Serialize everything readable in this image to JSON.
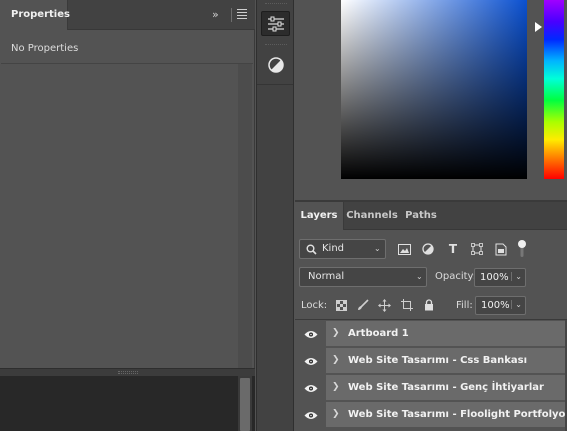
{
  "properties": {
    "tab_label": "Properties",
    "empty_message": "No Properties"
  },
  "icon_strip": {
    "buttons": [
      {
        "icon": "adjustments-sliders-icon",
        "active": true
      },
      {
        "icon": "color-adjustment-circle-icon",
        "active": false
      }
    ]
  },
  "layers": {
    "tabs": [
      {
        "label": "Layers",
        "active": true
      },
      {
        "label": "Channels",
        "active": false
      },
      {
        "label": "Paths",
        "active": false
      }
    ],
    "filter": {
      "kind_label": "Kind",
      "icons": [
        "image-filter-icon",
        "adjustment-filter-icon",
        "type-filter-icon",
        "shape-filter-icon",
        "smart-object-filter-icon"
      ]
    },
    "blend_mode": "Normal",
    "opacity_label": "Opacity:",
    "opacity_value": "100%",
    "lock_label": "Lock:",
    "lock_icons": [
      "lock-transparency-icon",
      "lock-image-icon",
      "lock-position-icon",
      "lock-artboard-icon",
      "lock-all-icon"
    ],
    "fill_label": "Fill:",
    "fill_value": "100%",
    "rows": [
      {
        "name": "Artboard 1"
      },
      {
        "name": "Web Site Tasarımı - Css Bankası"
      },
      {
        "name": "Web Site Tasarımı - Genç İhtiyarlar"
      },
      {
        "name": "Web Site Tasarımı - Floolight Portfolyo"
      }
    ]
  },
  "colors": {
    "panel_bg": "#535353",
    "tab_bar_bg": "#424242",
    "layer_row_bg": "#6a6a6a",
    "gradient_base": "#0a50d0"
  }
}
